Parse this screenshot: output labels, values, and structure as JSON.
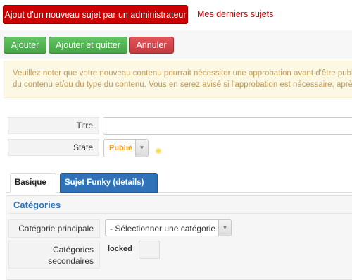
{
  "header": {
    "active_tab": "Ajout d'un nouveau sujet par un administrateur",
    "link": "Mes derniers sujets"
  },
  "toolbar": {
    "add_label": "Ajouter",
    "add_quit_label": "Ajouter et quitter",
    "cancel_label": "Annuler"
  },
  "notice": {
    "line1": "Veuillez noter que votre nouveau contenu pourrait nécessiter une approbation avant d'être publié. ",
    "line2": "du contenu et/ou du type du contenu. Vous en serez avisé si l'approbation est nécessaire, après a"
  },
  "form": {
    "title_label": "Titre",
    "title_value": "",
    "state_label": "State",
    "state_value": "Publié",
    "state_color": "#f39c12"
  },
  "tabs": {
    "basic": "Basique",
    "funky": "Sujet Funky (details)"
  },
  "categories": {
    "legend": "Catégories",
    "primary_label": "Catégorie principale",
    "primary_value": "- Sélectionner une catégorie -",
    "secondary_label_line1": "Catégories",
    "secondary_label_line2": "secondaires",
    "secondary_value": "locked"
  },
  "colors": {
    "brand_red": "#cc0000",
    "success_green": "#46a546",
    "danger_red": "#c33a3d",
    "tab_blue": "#2f72b8",
    "legend_blue": "#2a6fb2"
  }
}
